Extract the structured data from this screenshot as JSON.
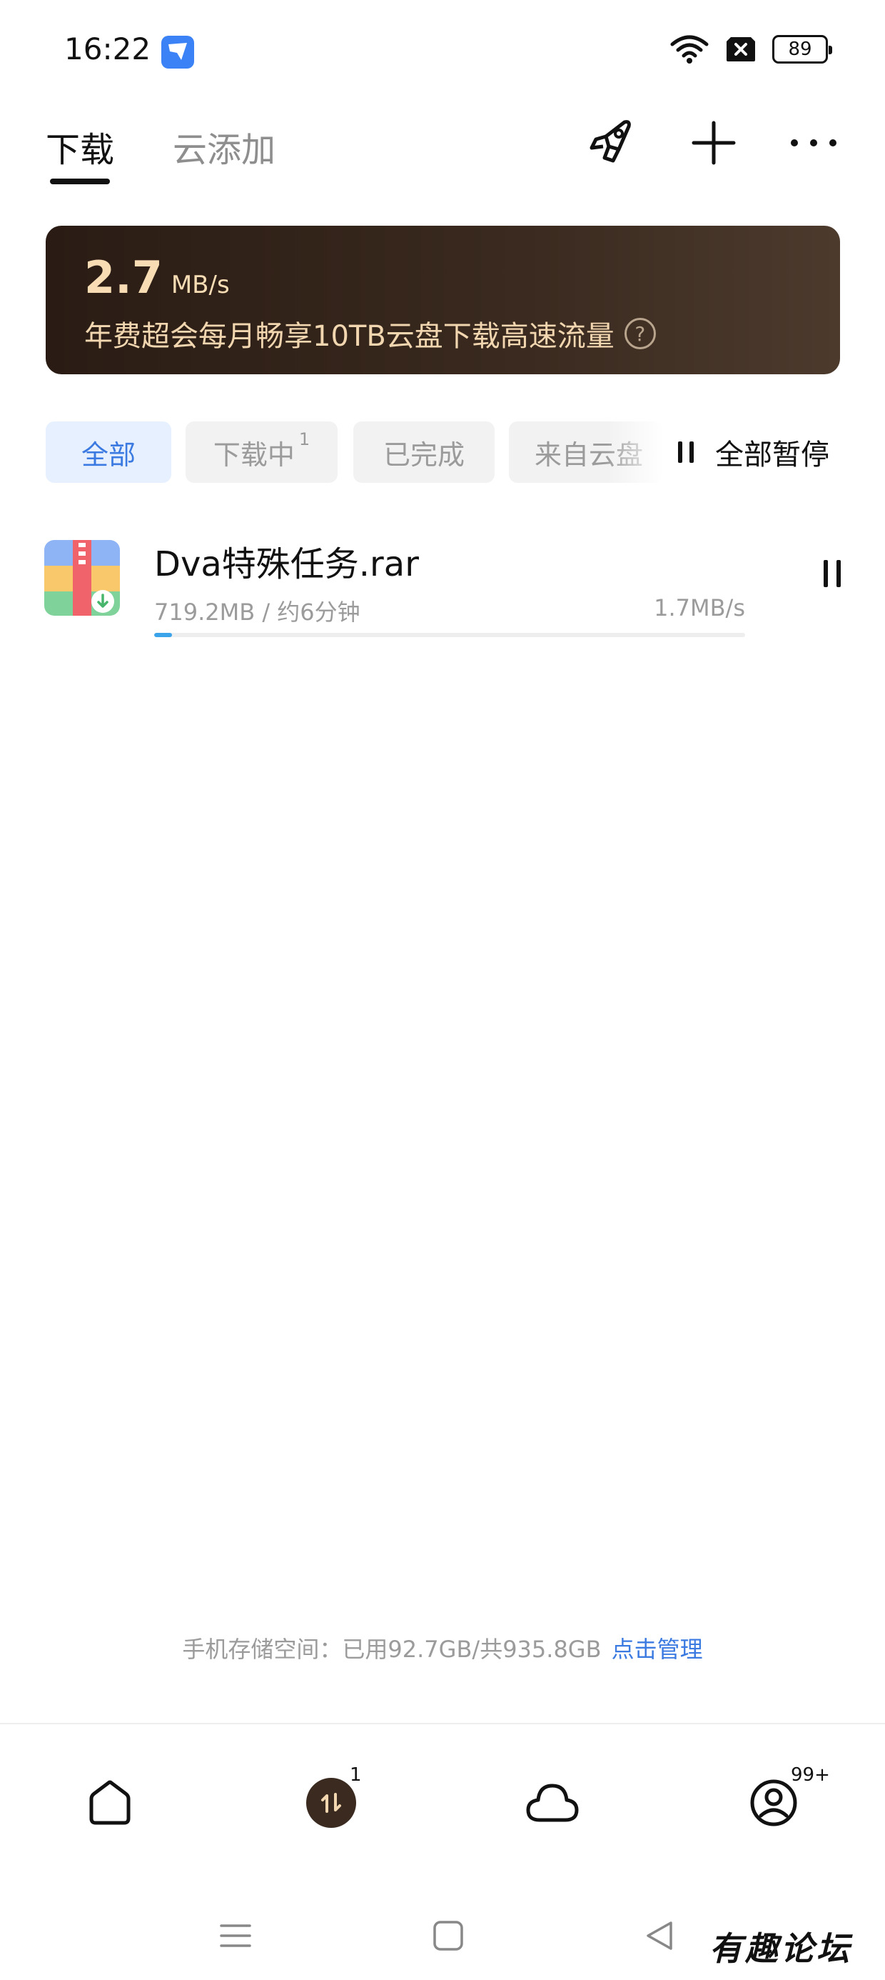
{
  "status_bar": {
    "time": "16:22",
    "battery": "89",
    "icons": [
      "app-notification-icon",
      "wifi-icon",
      "no-sim-icon",
      "battery-icon"
    ]
  },
  "header": {
    "tabs": [
      {
        "label": "下载",
        "active": true
      },
      {
        "label": "云添加",
        "active": false
      }
    ],
    "actions": [
      "rocket-icon",
      "add-icon",
      "more-icon"
    ]
  },
  "banner": {
    "speed_value": "2.7",
    "speed_unit": "MB/s",
    "promo_text": "年费超会每月畅享10TB云盘下载高速流量",
    "help_symbol": "?",
    "colors": {
      "background": "#2a1c14",
      "text": "#f2d6b0"
    }
  },
  "filters": {
    "chips": [
      {
        "label": "全部",
        "selected": true
      },
      {
        "label": "下载中",
        "count": "1",
        "selected": false
      },
      {
        "label": "已完成",
        "selected": false
      },
      {
        "label": "来自云盘",
        "selected": false
      }
    ],
    "pause_all_label": "全部暂停"
  },
  "downloads": [
    {
      "name": "Dva特殊任务.rar",
      "size": "719.2MB",
      "separator": " / ",
      "eta": "约6分钟",
      "speed": "1.7MB/s",
      "progress_percent": 3
    }
  ],
  "storage": {
    "text": "手机存储空间：已用92.7GB/共935.8GB",
    "link": "点击管理"
  },
  "bottom_nav": {
    "items": [
      "home-icon",
      "transfer-icon",
      "cloud-icon",
      "profile-icon"
    ],
    "transfer_badge": "1",
    "profile_badge": "99+"
  },
  "watermark": "有趣论坛",
  "accent_color": "#3b7ae0"
}
